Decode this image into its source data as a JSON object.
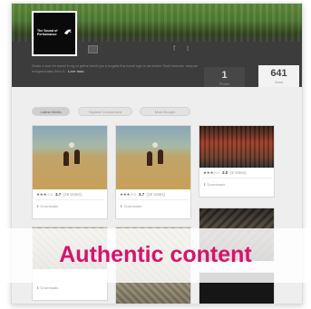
{
  "profile": {
    "logo_text": "The Sound of Performance",
    "logo_icon": "leaping-cat-logo-icon",
    "blurb": "Deals a tout eh world lu ng to gethe beeh (as a nogeta fha hoedi nge in aa shehe Ssal hmenes. seepne esdgeecrates lhea li...",
    "blurb_more": "Leer mas",
    "social": [
      "f",
      "t"
    ]
  },
  "stats": [
    {
      "value": "1",
      "label": "Photos"
    },
    {
      "value": "641",
      "label": "Views"
    }
  ],
  "tabs": [
    {
      "label": "Latest Media"
    },
    {
      "label": "Highest Commented"
    },
    {
      "label": "Most Bought"
    }
  ],
  "cards": [
    {
      "stars": "★★★☆☆",
      "rating": "3.7",
      "count": "(19 Votes)",
      "download": "Downloads"
    },
    {
      "stars": "★★★☆☆",
      "rating": "3.7",
      "count": "(19 Votes)",
      "download": "Downloads"
    },
    {
      "stars": "★★★☆☆",
      "rating": "3.0",
      "count": "(3 Votes)",
      "download": "Downloads"
    },
    {
      "stars": "",
      "rating": "",
      "count": "",
      "download": "Downloads"
    }
  ],
  "overlay": {
    "text": "Authentic content"
  },
  "colors": {
    "accent": "#d8136b",
    "header": "#3c3c3c",
    "page": "#eeeeee"
  }
}
